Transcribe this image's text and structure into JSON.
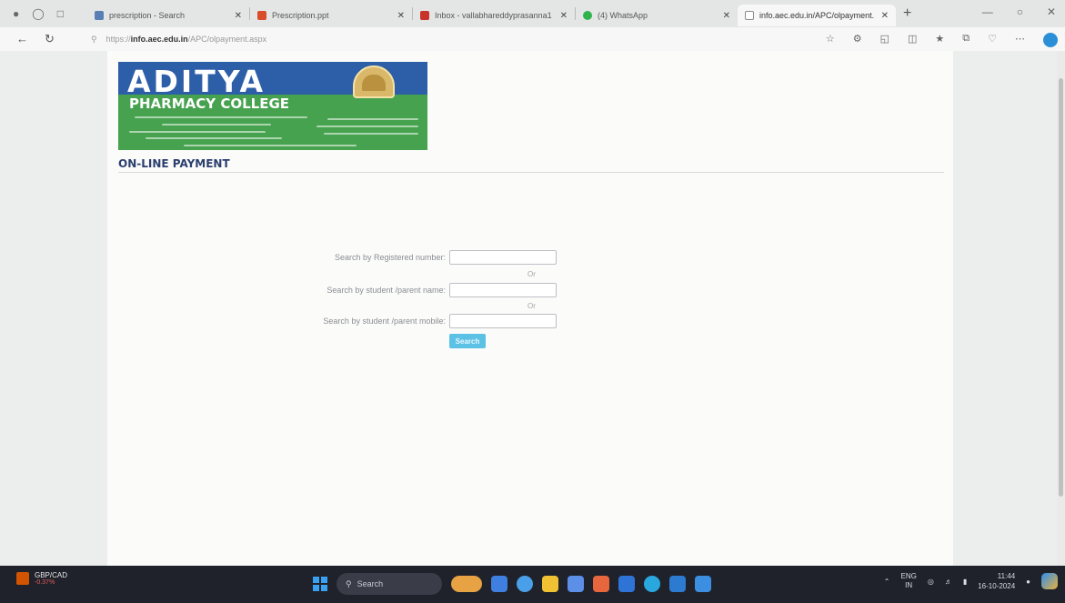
{
  "browser": {
    "tabs": [
      {
        "title": "prescription - Search",
        "favicon_color": "#5a7fb5",
        "active": false
      },
      {
        "title": "Prescription.ppt",
        "favicon_color": "#d84e2b",
        "active": false
      },
      {
        "title": "Inbox - vallabhareddyprasanna1",
        "favicon_color": "#c8332a",
        "active": false
      },
      {
        "title": "(4) WhatsApp",
        "favicon_color": "#2fb34b",
        "active": false
      },
      {
        "title": "info.aec.edu.in/APC/olpayment.",
        "favicon_color": "#8a8c8f",
        "active": true
      }
    ],
    "url_prefix": "https://",
    "url_host": "info.aec.edu.in",
    "url_path": "/APC/olpayment.aspx"
  },
  "page": {
    "banner": {
      "title": "ADITYA",
      "subtitle": "PHARMACY COLLEGE",
      "colors": {
        "top": "#2d5ea8",
        "bottom": "#46a24e"
      }
    },
    "heading": "ON-LINE PAYMENT",
    "form": {
      "reg_label": "Search by Registered number:",
      "or1": "Or",
      "name_label": "Search by student /parent name:",
      "or2": "Or",
      "mobile_label": "Search by student /parent mobile:",
      "reg_value": "",
      "name_value": "",
      "mobile_value": "",
      "search_button": "Search"
    }
  },
  "taskbar": {
    "stock_symbol": "GBP/CAD",
    "stock_change": "-0.37%",
    "search_placeholder": "Search",
    "lang_top": "ENG",
    "lang_bottom": "IN",
    "time": "11:44",
    "date": "16-10-2024"
  }
}
